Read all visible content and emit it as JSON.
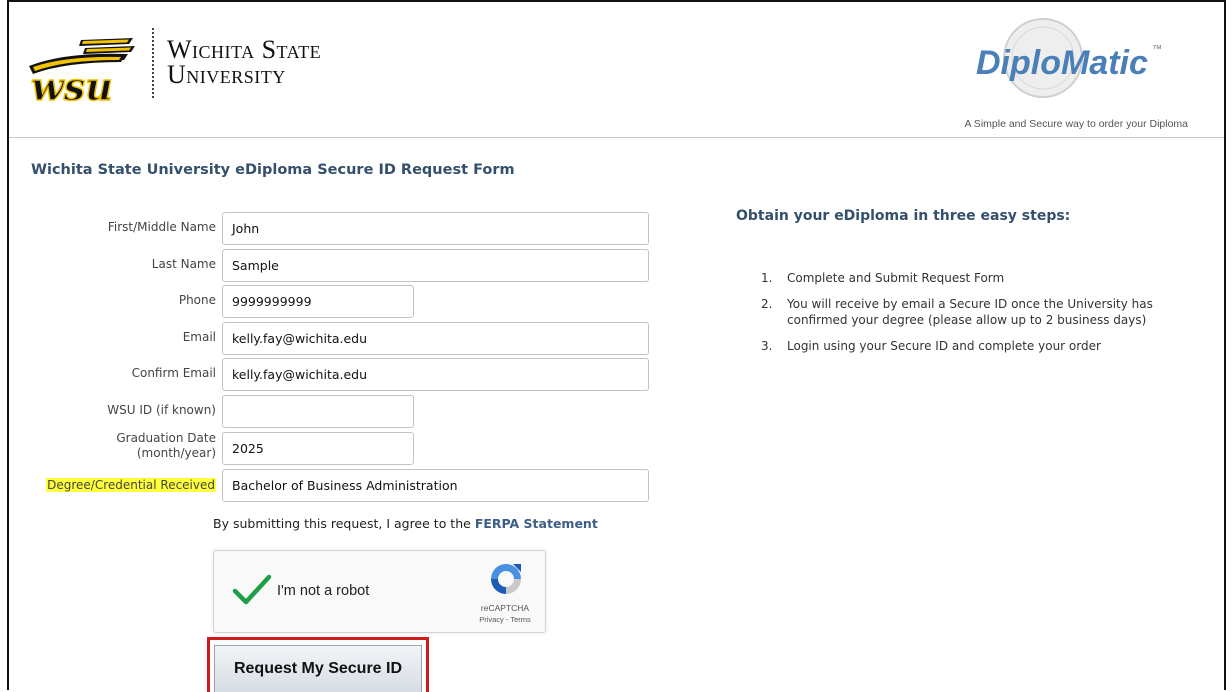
{
  "header": {
    "university_line1": "Wichita State",
    "university_line2": "University",
    "logo_text": "wsu",
    "diplomatic_brand": "DiploMatic",
    "diplomatic_tm": "™",
    "tagline": "A Simple and Secure way to order your Diploma"
  },
  "form": {
    "title": "Wichita State University eDiploma Secure ID Request Form",
    "fields": [
      {
        "label": "First/Middle Name",
        "value": ""
      },
      {
        "label": "Last Name",
        "value": ""
      },
      {
        "label": "Phone",
        "value": ""
      },
      {
        "label": "Email",
        "value": ""
      },
      {
        "label": "Confirm Email",
        "value": ""
      },
      {
        "label": "WSU ID (if known)",
        "value": ""
      },
      {
        "label_line1": "Graduation Date",
        "label_line2": "(month/year)",
        "value": ""
      },
      {
        "label": "Degree/Credential Received",
        "value": ""
      }
    ],
    "values": {
      "first_middle_name": "John",
      "last_name": "Sample",
      "phone": "9999999999",
      "email": "kelly.fay@wichita.edu",
      "confirm_email": "kelly.fay@wichita.edu",
      "wsu_id": "",
      "graduation_date": "2025",
      "degree": "Bachelor of Business Administration"
    },
    "agreement_text": "By submitting this request, I agree to the ",
    "ferpa_link": "FERPA Statement",
    "recaptcha": {
      "label": "I'm not a robot",
      "brand": "reCAPTCHA",
      "links": "Privacy - Terms"
    },
    "submit_label": "Request My Secure ID",
    "highlight_color": "#ffff3b",
    "submit_outline_color": "#d11b1b"
  },
  "steps": {
    "title": "Obtain your eDiploma in three easy steps:",
    "items": [
      {
        "num": "1.",
        "text": "Complete and Submit Request Form"
      },
      {
        "num": "2.",
        "text": "You will receive by email a Secure ID once the University has confirmed your degree (please allow up to 2 business days)"
      },
      {
        "num": "3.",
        "text": "Login using your Secure ID and complete your order"
      }
    ]
  },
  "colors": {
    "heading_blue": "#35506d",
    "link_blue": "#3d5e86",
    "wsu_gold": "#f2c300",
    "check_green": "#1e9e47"
  }
}
